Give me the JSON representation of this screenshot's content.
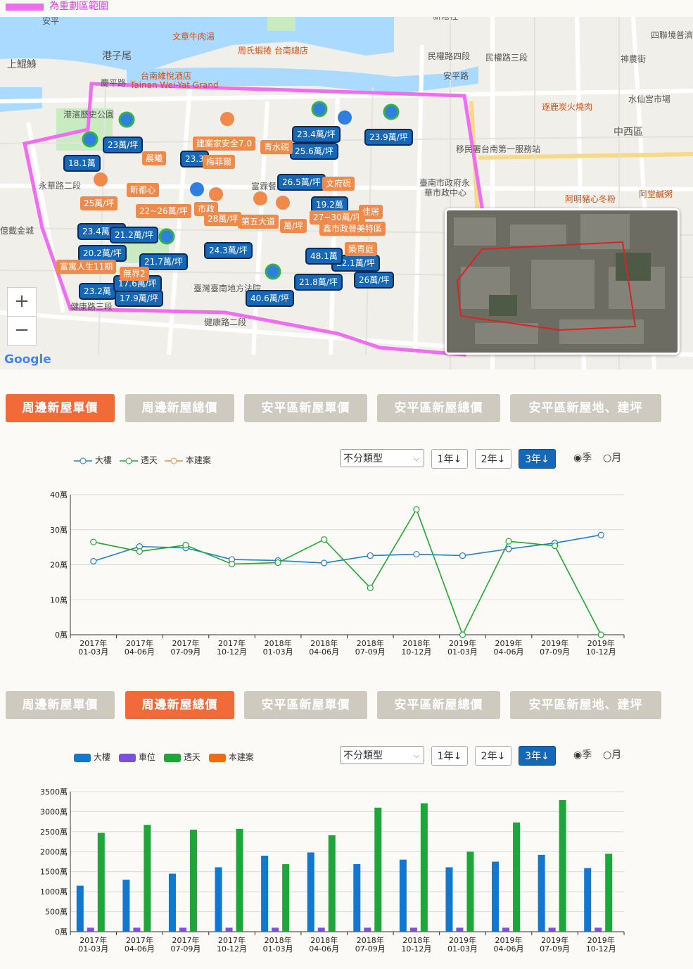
{
  "legend": {
    "label": "為重劃區範圍",
    "color": "#f06cf0"
  },
  "map": {
    "zoom_in": "+",
    "zoom_out": "−",
    "google_logo": "Google",
    "place_labels": [
      "安平",
      "港子尾",
      "上鯤鯓",
      "文章牛肉湯",
      "周氏蝦捲 台南總店",
      "台南維悅酒店",
      "Tainan Wei-Yat Grand",
      "民權路四段",
      "民權路三段",
      "安平路",
      "慶平路",
      "港濱歷史公園",
      "永華路二段",
      "億載金城",
      "臺南市政府永華市政中心",
      "移民署台南第一服務站",
      "逐鹿炭火燒肉",
      "中西區",
      "水仙宮市場",
      "神農街",
      "阿明豬心冬粉",
      "阿堂鹹粥",
      "四聯境普濟",
      "臺灣臺南地方法院",
      "健康路三段",
      "健康路二段",
      "富霖餐廳",
      "新港社"
    ],
    "markers_blue": [
      "23萬/坪",
      "18.1萬",
      "23.4萬/坪",
      "23.9萬/坪",
      "25.6萬/坪",
      "26.5萬/坪",
      "19.2萬",
      "23.4萬/坪",
      "21.2萬/坪",
      "20.2萬/坪",
      "24.3萬/坪",
      "22.1萬/坪",
      "26萬/坪",
      "21.8萬/坪",
      "40.6萬/坪",
      "23.2萬",
      "17.9萬/坪",
      "17.6萬/坪",
      "21.7萬/坪",
      "23.3",
      "48.1萬"
    ],
    "markers_orange": [
      "晨曦",
      "建案家安全7.0",
      "青水硯",
      "梅菲爾",
      "文府硯",
      "昕都心",
      "25萬/坪",
      "22~26萬/坪",
      "市政",
      "28萬/坪",
      "第五大道",
      "27~30萬/坪",
      "萬/坪",
      "佳居",
      "鑫市政晉美特區",
      "築青庭",
      "富寓人生11期",
      "無界2"
    ]
  },
  "tabs": [
    "周邊新屋單價",
    "周邊新屋總價",
    "安平區新屋單價",
    "安平區新屋總價",
    "安平區新屋地、建坪"
  ],
  "controls": {
    "type_select": "不分類型",
    "btn_1y": "1年↓",
    "btn_2y": "2年↓",
    "btn_3y": "3年↓",
    "radio_season": "◉季",
    "radio_month": "○月"
  },
  "chart_data": [
    {
      "type": "line",
      "series": [
        {
          "name": "大樓",
          "color": "#1f7fd0",
          "values": [
            21,
            25.2,
            24.8,
            21.5,
            21.2,
            20.5,
            22.6,
            23.0,
            22.6,
            24.5,
            26.2,
            28.5
          ]
        },
        {
          "name": "透天",
          "color": "#22a733",
          "values": [
            26.5,
            23.8,
            25.6,
            20.2,
            20.6,
            27.2,
            13.4,
            35.8,
            0,
            26.7,
            25.4,
            0
          ]
        },
        {
          "name": "本建案",
          "color": "#f08a4b",
          "values": []
        }
      ],
      "categories": [
        [
          "2017年",
          "01-03月"
        ],
        [
          "2017年",
          "04-06月"
        ],
        [
          "2017年",
          "07-09月"
        ],
        [
          "2017年",
          "10-12月"
        ],
        [
          "2018年",
          "01-03月"
        ],
        [
          "2018年",
          "04-06月"
        ],
        [
          "2018年",
          "07-09月"
        ],
        [
          "2018年",
          "10-12月"
        ],
        [
          "2019年",
          "01-03月"
        ],
        [
          "2019年",
          "04-06月"
        ],
        [
          "2019年",
          "07-09月"
        ],
        [
          "2019年",
          "10-12月"
        ]
      ],
      "ylim": [
        0,
        40
      ],
      "yticks": [
        "0萬",
        "10萬",
        "20萬",
        "30萬",
        "40萬"
      ],
      "grid": true,
      "legend": "top-left"
    },
    {
      "type": "bar",
      "series": [
        {
          "name": "大樓",
          "color": "#1278cf",
          "values": [
            1150,
            1300,
            1450,
            1610,
            1900,
            1980,
            1690,
            1800,
            1610,
            1750,
            1920,
            1590
          ]
        },
        {
          "name": "車位",
          "color": "#7b4fe0",
          "values": [
            100,
            100,
            100,
            100,
            100,
            100,
            100,
            100,
            100,
            100,
            100,
            100
          ]
        },
        {
          "name": "透天",
          "color": "#1fa63a",
          "values": [
            2470,
            2670,
            2550,
            2570,
            1690,
            2410,
            3100,
            3210,
            2000,
            2730,
            3290,
            1950
          ]
        },
        {
          "name": "本建案",
          "color": "#ef6c12",
          "values": []
        }
      ],
      "categories": [
        [
          "2017年",
          "01-03月"
        ],
        [
          "2017年",
          "04-06月"
        ],
        [
          "2017年",
          "07-09月"
        ],
        [
          "2017年",
          "10-12月"
        ],
        [
          "2018年",
          "01-03月"
        ],
        [
          "2018年",
          "04-06月"
        ],
        [
          "2018年",
          "07-09月"
        ],
        [
          "2018年",
          "10-12月"
        ],
        [
          "2019年",
          "01-03月"
        ],
        [
          "2019年",
          "04-06月"
        ],
        [
          "2019年",
          "07-09月"
        ],
        [
          "2019年",
          "10-12月"
        ]
      ],
      "ylim": [
        0,
        3500
      ],
      "yticks": [
        "0萬",
        "500萬",
        "1000萬",
        "1500萬",
        "2000萬",
        "2500萬",
        "3000萬",
        "3500萬"
      ],
      "grid": true,
      "legend": "top-left"
    }
  ]
}
